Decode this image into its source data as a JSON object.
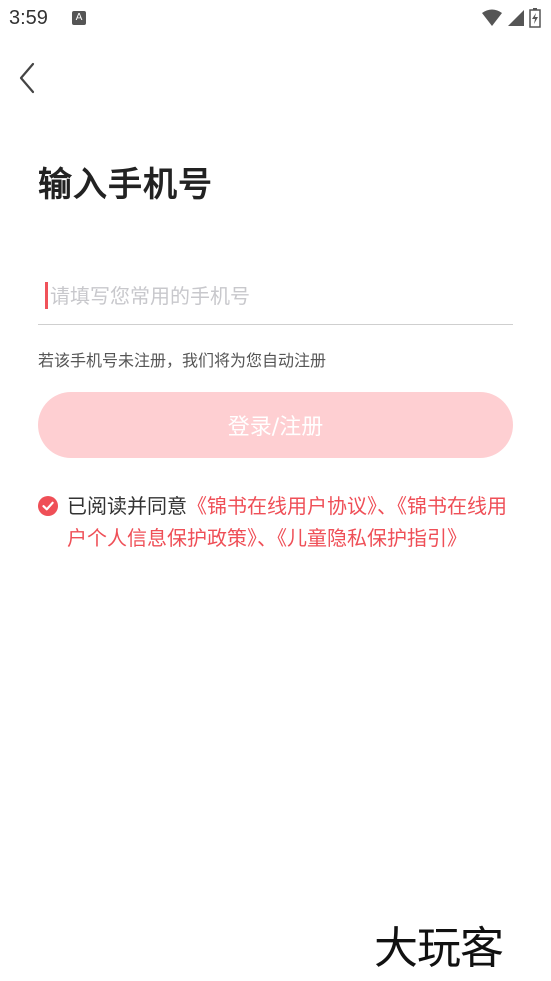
{
  "status_bar": {
    "time": "3:59",
    "notification_icon": "A",
    "icons": [
      "wifi-icon",
      "signal-icon",
      "battery-charging-icon"
    ]
  },
  "nav": {
    "back_icon": "chevron-left-icon"
  },
  "page": {
    "title": "输入手机号",
    "phone_placeholder": "请填写您常用的手机号",
    "phone_value": "",
    "hint": "若该手机号未注册，我们将为您自动注册",
    "login_button": "登录/注册"
  },
  "agreement": {
    "checked": true,
    "prefix": "已阅读并同意",
    "link1": "《锦书在线用户协议》",
    "sep1": "、",
    "link2": "《锦书在线用户个人信息保护政策》",
    "sep2": "、",
    "link3": "《儿童隐私保护指引》"
  },
  "watermark": "大玩客",
  "colors": {
    "accent": "#ef4f57",
    "button_disabled": "#fecfd2",
    "placeholder": "#c8c8cc"
  }
}
